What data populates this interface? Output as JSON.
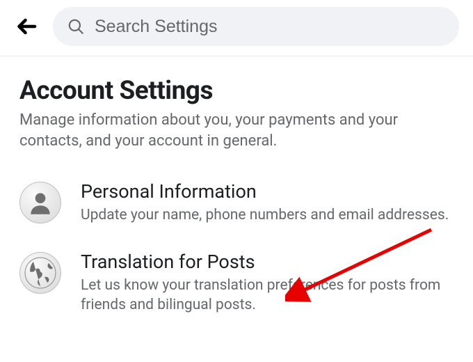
{
  "header": {
    "search_placeholder": "Search Settings"
  },
  "page": {
    "title": "Account Settings",
    "subtitle": "Manage information about you, your payments and your contacts, and your account in general."
  },
  "items": [
    {
      "icon": "person-icon",
      "title": "Personal Information",
      "desc": "Update your name, phone numbers and email addresses."
    },
    {
      "icon": "globe-icon",
      "title": "Translation for Posts",
      "desc": "Let us know your translation preferences for posts from friends and bilingual posts."
    }
  ],
  "annotation": {
    "arrow_color": "#e60000"
  }
}
